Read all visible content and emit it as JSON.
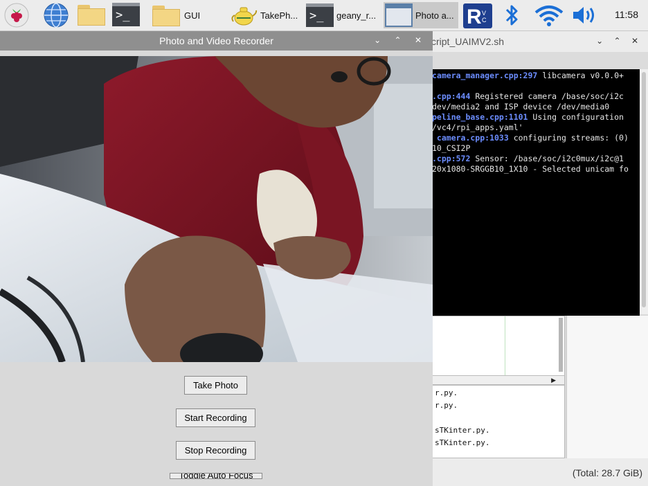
{
  "taskbar": {
    "menu_icon": "raspberry-icon",
    "tasks": [
      {
        "label": "GUI",
        "icon": "folder-icon"
      },
      {
        "label": "TakePh...",
        "icon": "teapot-icon"
      },
      {
        "label": "geany_r...",
        "icon": "terminal-icon"
      },
      {
        "label": "Photo a...",
        "icon": "window-icon",
        "active": true
      }
    ],
    "clock": "11:58"
  },
  "app_window": {
    "title": "Photo and Video Recorder",
    "controls": [
      "⌄",
      "⌃",
      "✕"
    ],
    "buttons": {
      "take_photo": "Take Photo",
      "start_recording": "Start Recording",
      "stop_recording": "Stop Recording",
      "toggle_af": "Toggle Auto Focus"
    }
  },
  "bg_window": {
    "title": "cript_UAIMV2.sh",
    "controls": [
      "⌄",
      "⌃",
      "✕"
    ]
  },
  "terminal_lines": [
    [
      {
        "t": "camera_manager.cpp:297",
        "c": "blue"
      },
      {
        "t": " libcamera v0.0.0+"
      }
    ],
    [
      {
        "t": ""
      }
    ],
    [
      {
        "t": ".cpp:444",
        "c": "blue"
      },
      {
        "t": " Registered camera /base/soc/i2c"
      }
    ],
    [
      {
        "t": "dev/media2 and ISP device /dev/media0"
      }
    ],
    [
      {
        "t": "peline_base.cpp:1101",
        "c": "blue"
      },
      {
        "t": " Using configuration"
      }
    ],
    [
      {
        "t": "/vc4/rpi_apps.yaml'"
      }
    ],
    [
      {
        "t": " camera.cpp:1033",
        "c": "blue"
      },
      {
        "t": " configuring streams: (0)"
      }
    ],
    [
      {
        "t": "10_CSI2P"
      }
    ],
    [
      {
        "t": ".cpp:572",
        "c": "blue"
      },
      {
        "t": " Sensor: /base/soc/i2c0mux/i2c@1"
      }
    ],
    [
      {
        "t": "20x1080-SRGGB10_1X10 - Selected unicam fo"
      }
    ]
  ],
  "file_list": [
    "r.py.",
    "r.py.",
    "",
    "sTKinter.py.",
    "sTKinter.py."
  ],
  "status": "(Total: 28.7 GiB)"
}
